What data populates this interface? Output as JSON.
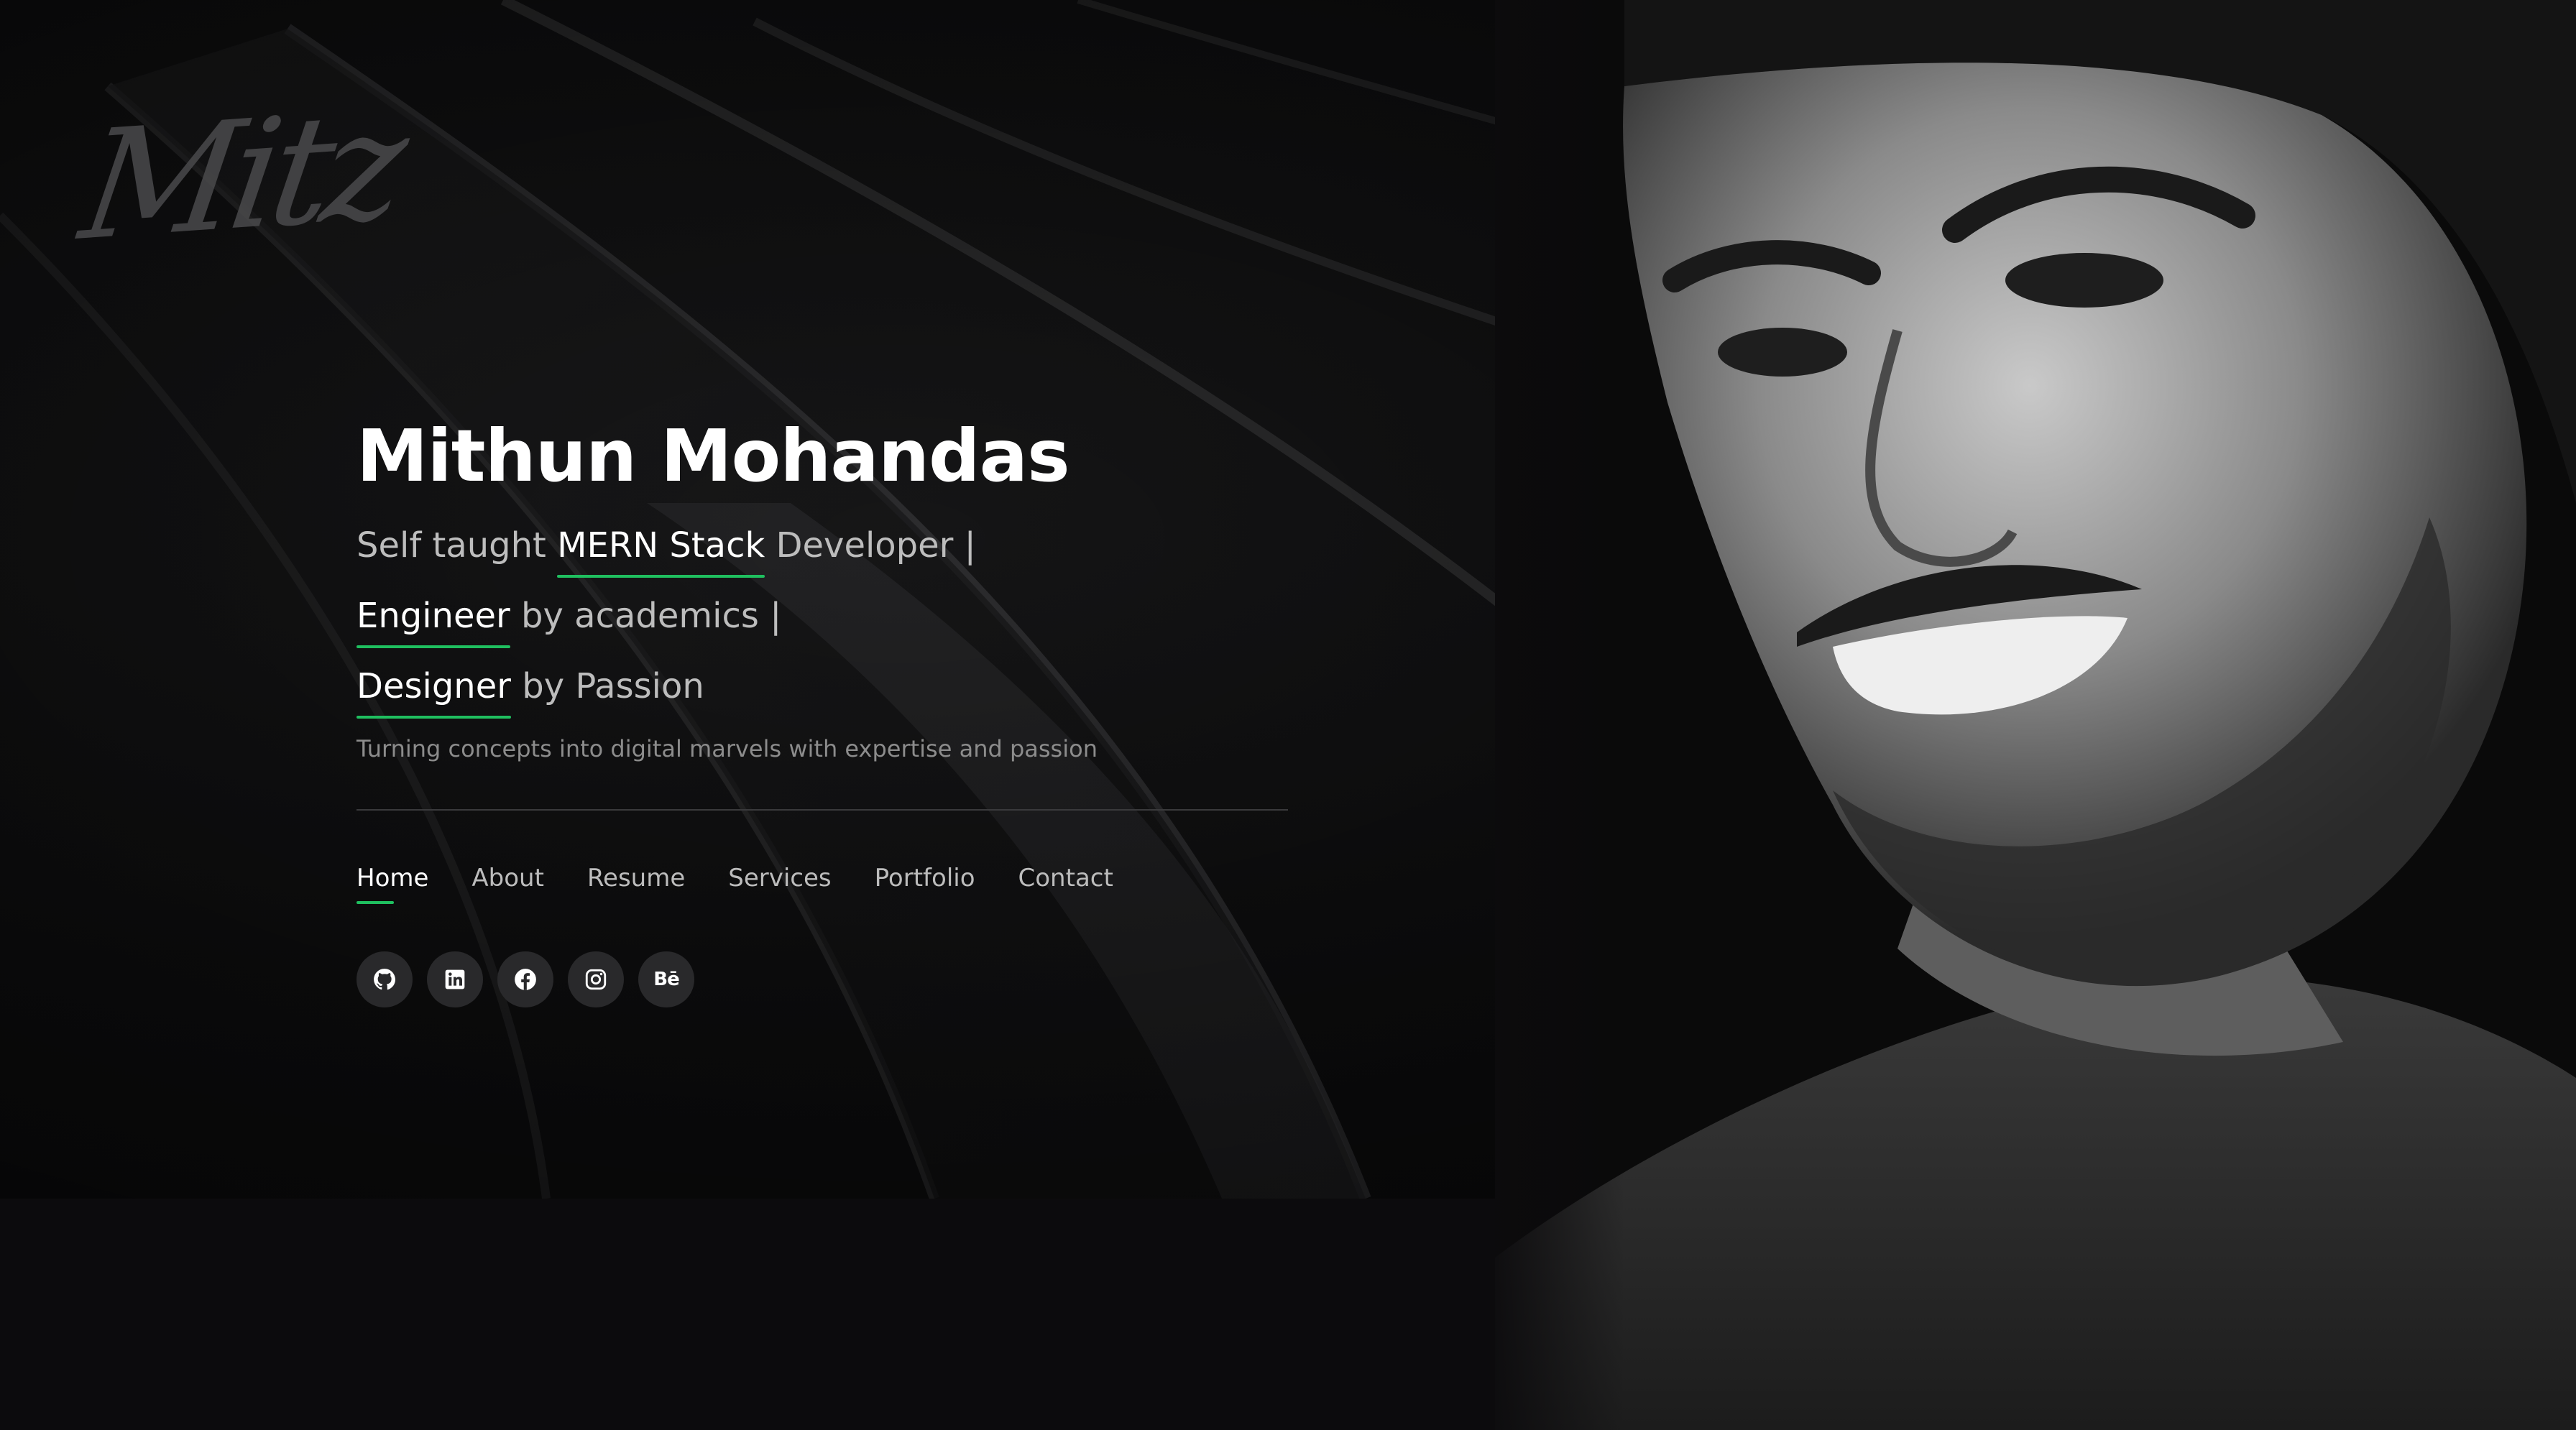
{
  "brand": {
    "logo_text": "Mitz"
  },
  "hero": {
    "name": "Mithun Mohandas",
    "line1": {
      "before": "Self taught ",
      "highlight": "MERN Stack",
      "after": " Developer |"
    },
    "line2": {
      "highlight": "Engineer",
      "after": " by academics |"
    },
    "line3": {
      "highlight": "Designer",
      "after": " by Passion"
    },
    "tagline": "Turning concepts into digital marvels with expertise and passion"
  },
  "nav": {
    "items": [
      {
        "label": "Home",
        "active": true
      },
      {
        "label": "About",
        "active": false
      },
      {
        "label": "Resume",
        "active": false
      },
      {
        "label": "Services",
        "active": false
      },
      {
        "label": "Portfolio",
        "active": false
      },
      {
        "label": "Contact",
        "active": false
      }
    ]
  },
  "social": {
    "items": [
      {
        "icon": "github-icon"
      },
      {
        "icon": "linkedin-icon"
      },
      {
        "icon": "facebook-icon"
      },
      {
        "icon": "instagram-icon"
      },
      {
        "icon": "behance-icon",
        "label": "Bē"
      }
    ]
  },
  "colors": {
    "accent": "#1fbf5f",
    "background": "#0c0b0d",
    "text_primary": "#ffffff",
    "text_secondary": "#bdbdbd",
    "text_muted": "#8c8c8c",
    "social_bg": "#29292b"
  }
}
